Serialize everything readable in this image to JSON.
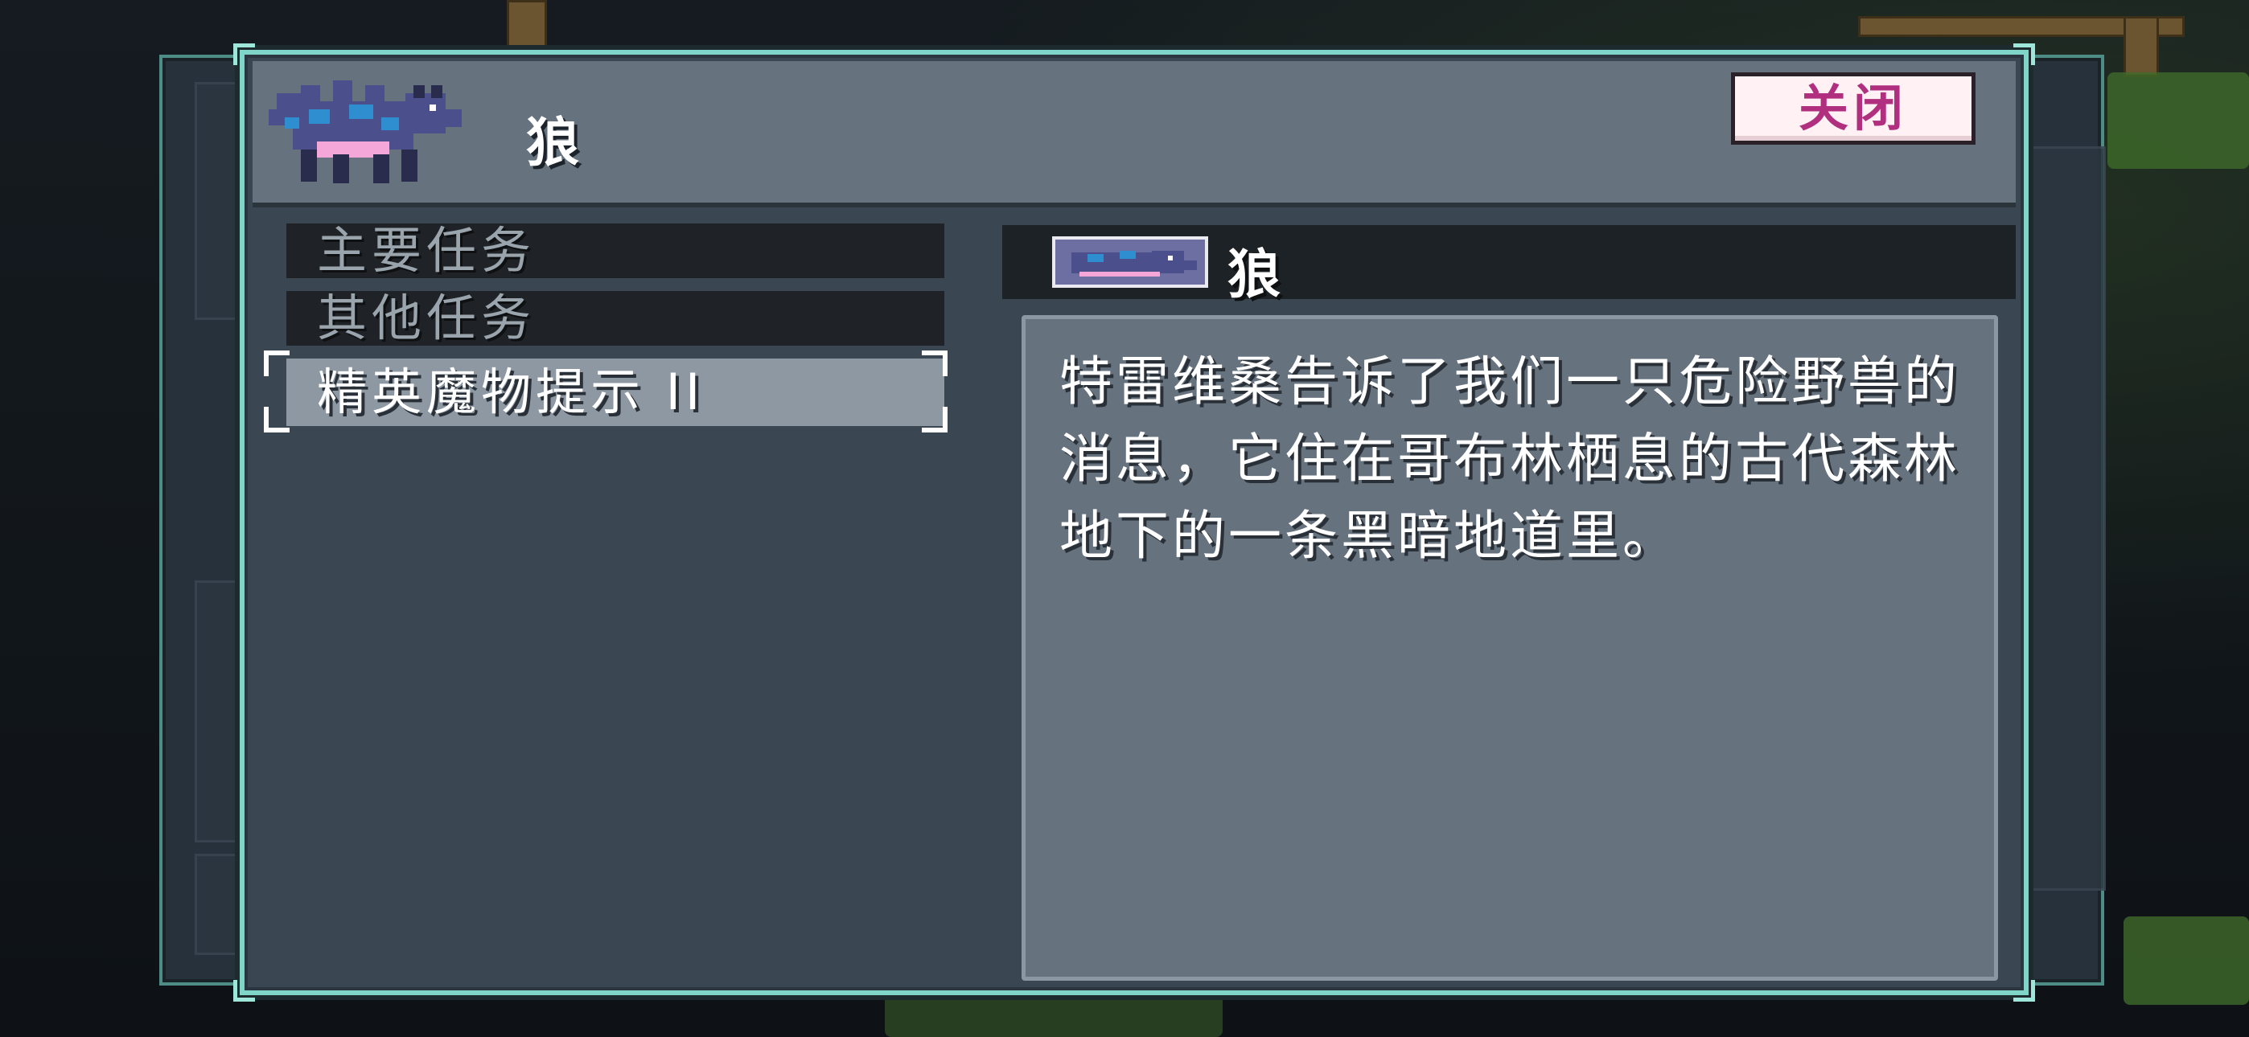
{
  "header": {
    "title": "狼",
    "close_label": "关闭"
  },
  "quests": [
    {
      "label": "主要任务",
      "selected": false
    },
    {
      "label": "其他任务",
      "selected": false
    },
    {
      "label": "精英魔物提示 II",
      "selected": true
    }
  ],
  "detail": {
    "monster_name": "狼",
    "description": "特雷维桑告诉了我们一只危险野兽的消息，它住在哥布林栖息的古代森林地下的一条黑暗地道里。"
  },
  "colors": {
    "modal_border": "#7fd6c8",
    "close_text": "#b0307f",
    "wolf_body": "#4b4f8c",
    "wolf_spots": "#2e8ecf",
    "wolf_belly": "#f4a7d8"
  }
}
